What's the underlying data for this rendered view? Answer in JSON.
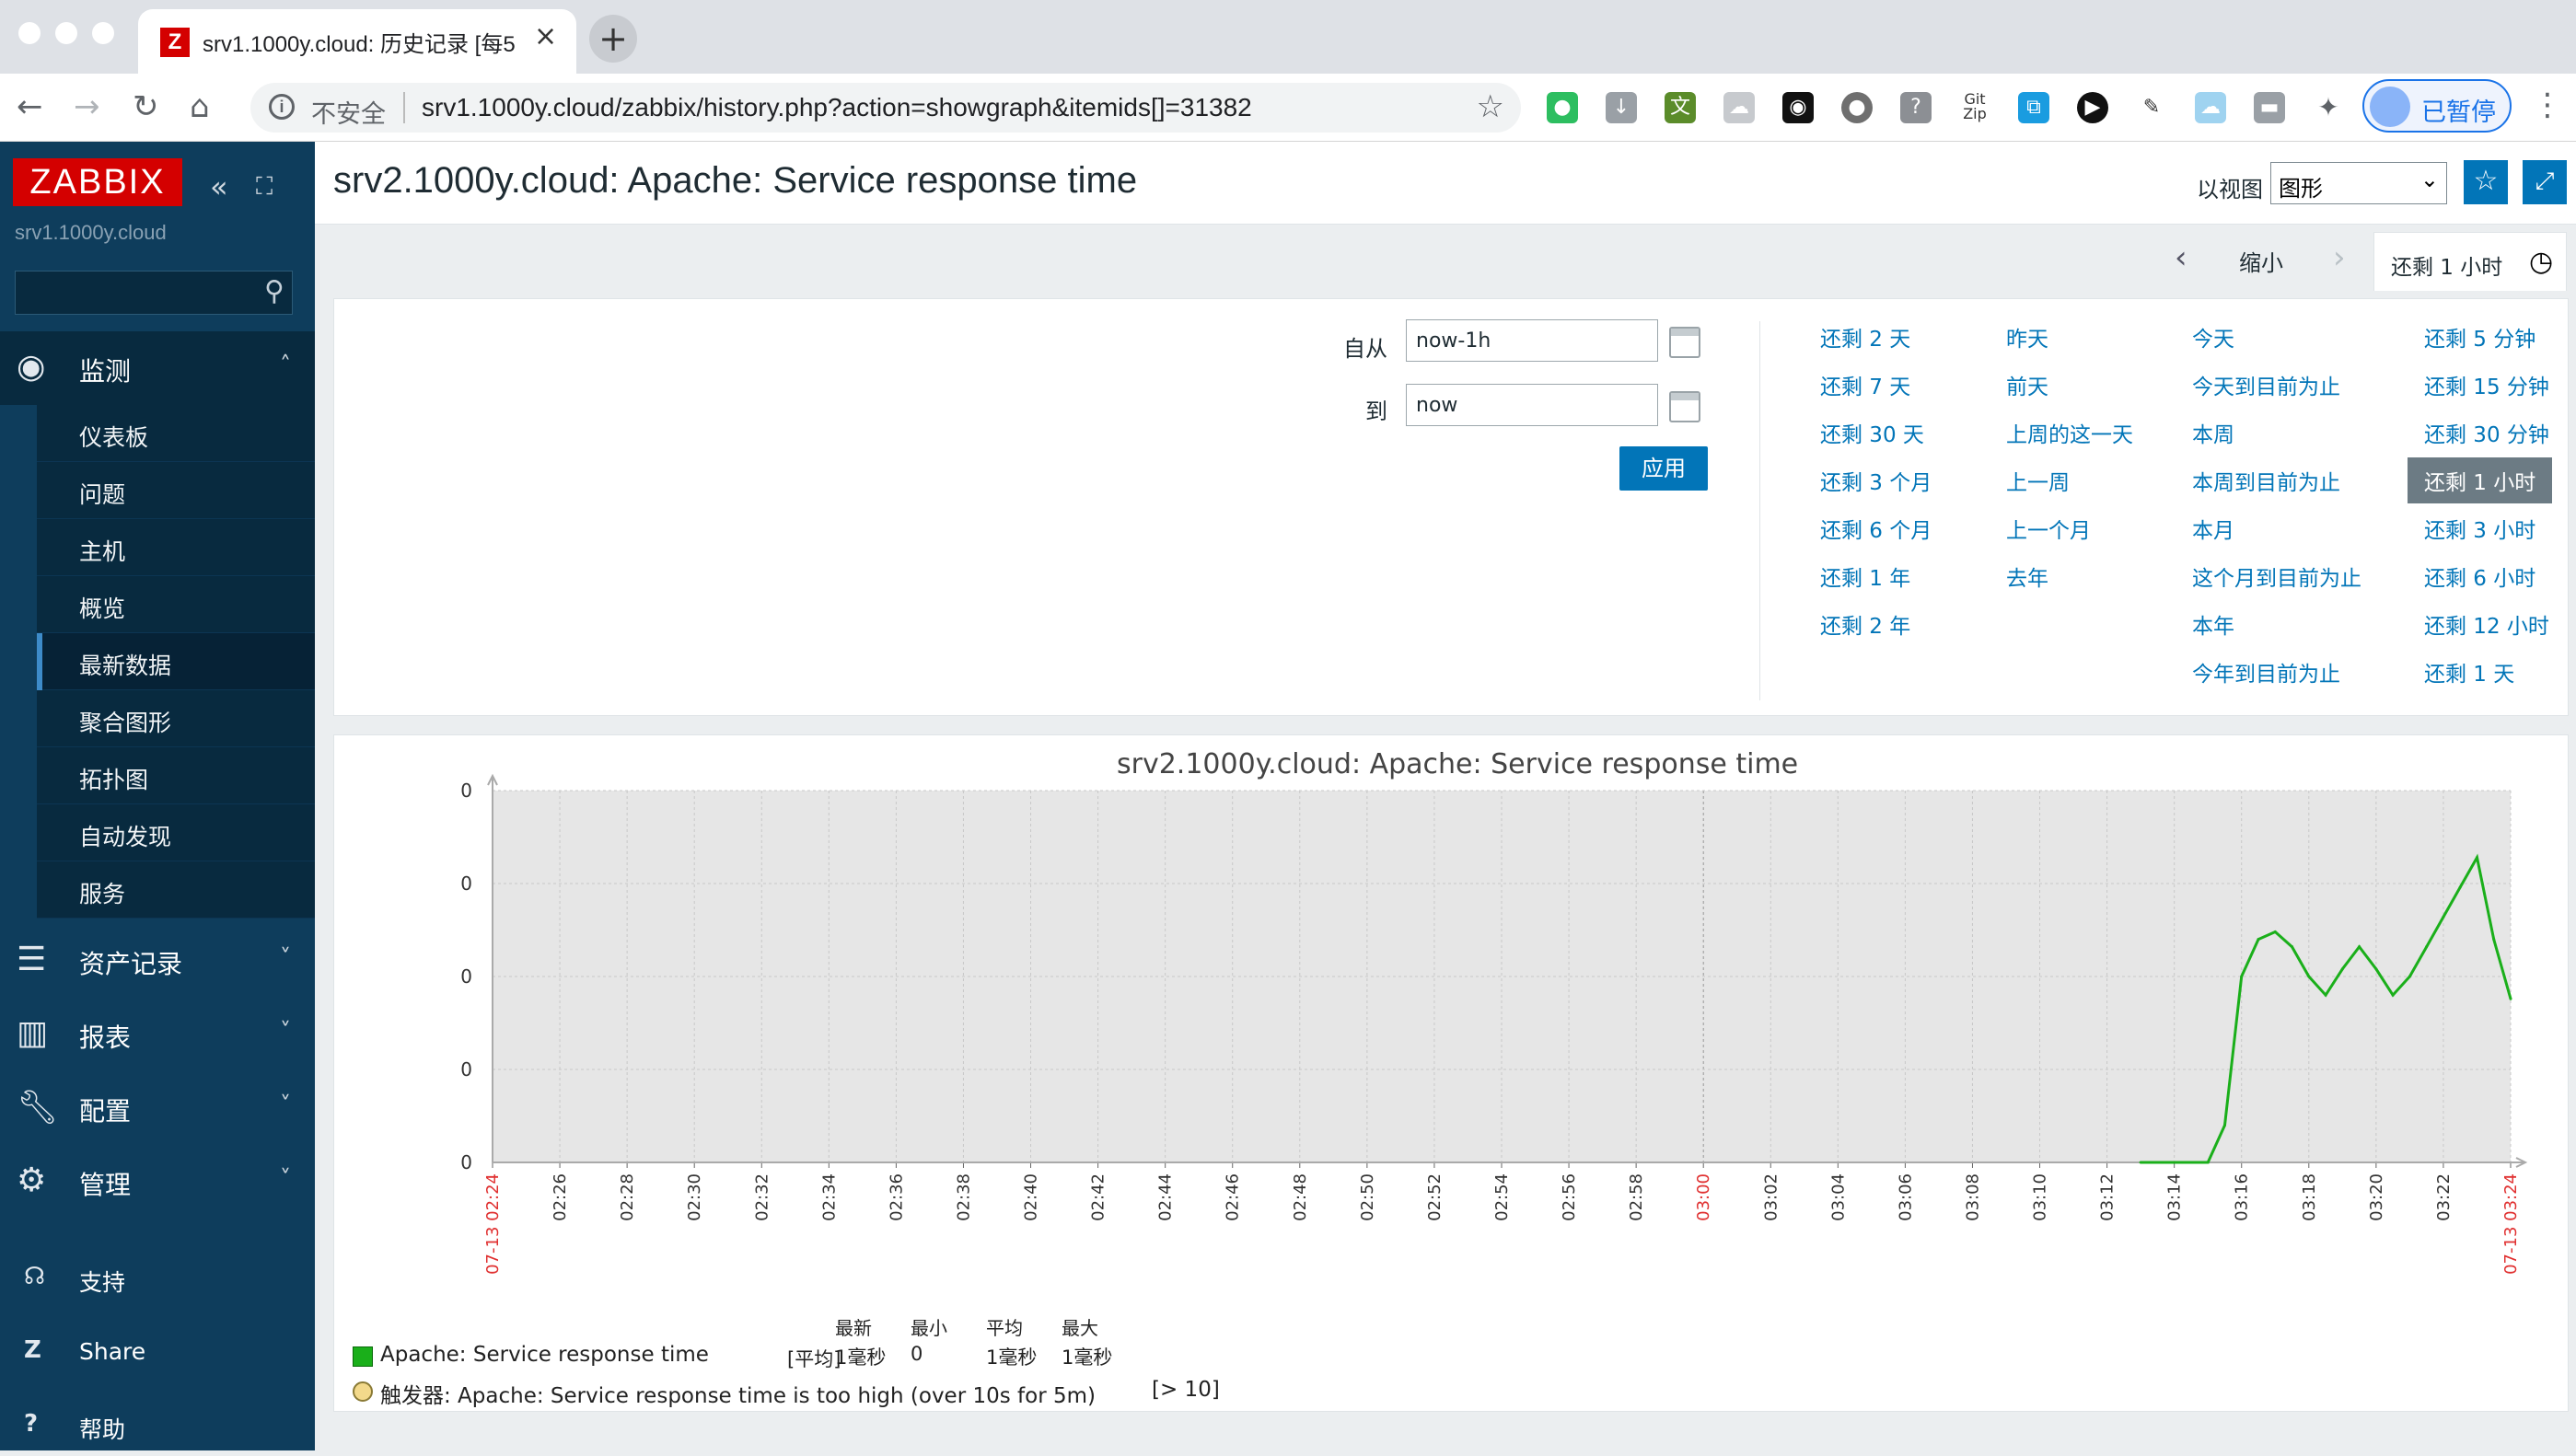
{
  "browser": {
    "tab_title": "srv1.1000y.cloud: 历史记录 [每5",
    "tab_close": "×",
    "new_tab": "+",
    "insecure_label": "不安全",
    "url": "srv1.1000y.cloud/zabbix/history.php?action=showgraph&itemids[]=31382",
    "profile_label": "已暂停"
  },
  "sidebar": {
    "logo": "ZABBIX",
    "server": "srv1.1000y.cloud",
    "monitoring_label": "监测",
    "monitoring_items": [
      "仪表板",
      "问题",
      "主机",
      "概览",
      "最新数据",
      "聚合图形",
      "拓扑图",
      "自动发现",
      "服务"
    ],
    "active_item": "最新数据",
    "inventory_label": "资产记录",
    "reports_label": "报表",
    "config_label": "配置",
    "admin_label": "管理",
    "support_label": "支持",
    "share_label": "Share",
    "help_label": "帮助"
  },
  "header": {
    "title": "srv2.1000y.cloud: Apache: Service response time",
    "view_as_label": "以视图",
    "view_as_value": "图形"
  },
  "timetabs": {
    "zoom_label": "缩小",
    "active_tab": "还剩 1 小时"
  },
  "filter": {
    "from_label": "自从",
    "from_value": "now-1h",
    "to_label": "到",
    "to_value": "now",
    "apply_label": "应用",
    "quick_col1": [
      "还剩 2 天",
      "还剩 7 天",
      "还剩 30 天",
      "还剩 3 个月",
      "还剩 6 个月",
      "还剩 1 年",
      "还剩 2 年"
    ],
    "quick_col2": [
      "昨天",
      "前天",
      "上周的这一天",
      "上一周",
      "上一个月",
      "去年"
    ],
    "quick_col3": [
      "今天",
      "今天到目前为止",
      "本周",
      "本周到目前为止",
      "本月",
      "这个月到目前为止",
      "本年",
      "今年到目前为止"
    ],
    "quick_col4": [
      "还剩 5 分钟",
      "还剩 15 分钟",
      "还剩 30 分钟",
      "还剩 1 小时",
      "还剩 3 小时",
      "还剩 6 小时",
      "还剩 12 小时",
      "还剩 1 天"
    ],
    "selected_quick": "还剩 1 小时"
  },
  "chart_data": {
    "type": "line",
    "title": "srv2.1000y.cloud: Apache: Service response time",
    "y_tick_labels": [
      "0",
      "0",
      "0",
      "0",
      "0"
    ],
    "x_tick_labels": [
      "07-13 02:24",
      "02:26",
      "02:28",
      "02:30",
      "02:32",
      "02:34",
      "02:36",
      "02:38",
      "02:40",
      "02:42",
      "02:44",
      "02:46",
      "02:48",
      "02:50",
      "02:52",
      "02:54",
      "02:56",
      "02:58",
      "03:00",
      "03:02",
      "03:04",
      "03:06",
      "03:08",
      "03:10",
      "03:12",
      "03:14",
      "03:16",
      "03:18",
      "03:20",
      "03:22",
      "07-13 03:24"
    ],
    "highlight_ticks": [
      "07-13 02:24",
      "03:00",
      "07-13 03:24"
    ],
    "series": [
      {
        "name": "Apache: Service response time",
        "color": "#1aaf1a",
        "x": [
          "03:13",
          "03:14",
          "03:15",
          "03:15.5",
          "03:16",
          "03:16.5",
          "03:17",
          "03:17.5",
          "03:18",
          "03:18.5",
          "03:19",
          "03:19.5",
          "03:20",
          "03:20.5",
          "03:21",
          "03:21.5",
          "03:22",
          "03:22.5",
          "03:23",
          "03:23.5",
          "03:24"
        ],
        "values": [
          0.0,
          0.0,
          0.0,
          0.1,
          0.5,
          0.6,
          0.62,
          0.58,
          0.5,
          0.45,
          0.52,
          0.58,
          0.52,
          0.45,
          0.5,
          0.58,
          0.66,
          0.74,
          0.82,
          0.6,
          0.44
        ]
      }
    ],
    "legend": {
      "item_label": "Apache: Service response time",
      "func_label": "[平均]",
      "stat_headers": [
        "最新",
        "最小",
        "平均",
        "最大"
      ],
      "stat_values": [
        "1毫秒",
        "0",
        "1毫秒",
        "1毫秒"
      ],
      "trigger_label": "触发器: Apache: Service response time is too high (over 10s for 5m)",
      "trigger_cond": "[> 10]"
    }
  }
}
